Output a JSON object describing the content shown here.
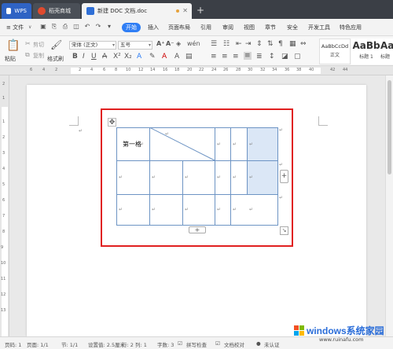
{
  "tabs": [
    {
      "label": "WPS"
    },
    {
      "label": "稻壳商城"
    },
    {
      "label": "新建 DOC 文档.doc"
    }
  ],
  "new_tab": "+",
  "menu": {
    "file": "≡ 文件",
    "file_arrow": "∨",
    "items": [
      "开始",
      "插入",
      "页面布局",
      "引用",
      "审阅",
      "视图",
      "章节",
      "安全",
      "开发工具",
      "特色应用"
    ]
  },
  "ribbon": {
    "paste": "粘贴",
    "cut": "剪切",
    "copy": "复制",
    "format_painter": "格式刷",
    "font_name": "宋体 (正文)",
    "font_size": "五号",
    "style_normal_sample": "AaBbCcDd",
    "style_normal": "正文",
    "style_h1_sample": "AaBb",
    "style_h1": "标题 1",
    "style_h2_sample": "AaB",
    "style_h2": "标题"
  },
  "ruler_numbers": [
    "6",
    "4",
    "2",
    "",
    "2",
    "4",
    "6",
    "8",
    "10",
    "12",
    "14",
    "16",
    "18",
    "20",
    "22",
    "24",
    "26",
    "28",
    "30",
    "32",
    "34",
    "36",
    "38",
    "40",
    "42",
    "44"
  ],
  "vruler_numbers": [
    "2",
    "1",
    "1",
    "2",
    "3",
    "4",
    "5",
    "6",
    "7",
    "8",
    "9",
    "10",
    "11",
    "12",
    "13"
  ],
  "table": {
    "first_cell": "第一格",
    "add_col": "+",
    "add_row": "+",
    "move_handle": "✥",
    "resize_handle": "↘"
  },
  "para_mark": "↵",
  "status": {
    "page_num": "页码: 1",
    "pages": "页面: 1/1",
    "section": "节: 1/1",
    "setting": "设置值: 2.5厘米",
    "row": "行: 2",
    "col": "列: 1",
    "words": "字数: 3",
    "spell": "拼写检查",
    "proof": "文档校对",
    "cert": "未认证"
  },
  "watermark": {
    "text": "windows系统家园",
    "url": "www.ruinafu.com"
  },
  "colors": {
    "accent": "#2f7ef5",
    "highlight": "#e02020",
    "table_line": "#6d94c4",
    "selected_cell": "#dbe7f6"
  }
}
